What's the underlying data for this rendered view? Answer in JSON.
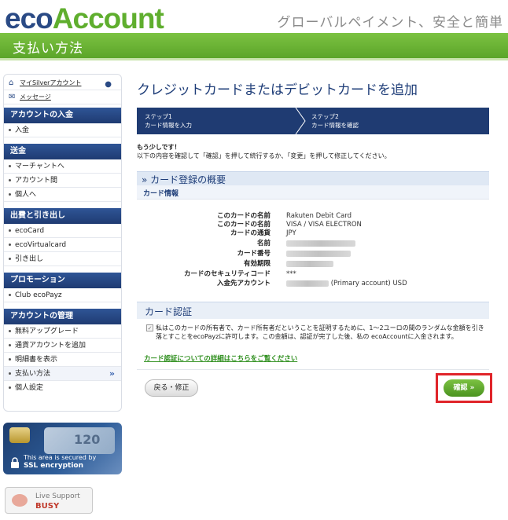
{
  "header": {
    "logo_eco": "eco",
    "logo_account": "Account",
    "tagline": "グローバルペイメント、安全と簡単",
    "page_title": "支払い方法"
  },
  "sidebar": {
    "top_items": [
      {
        "label": "マイSilverアカウント",
        "icon": "home-icon"
      },
      {
        "label": "メッセージ",
        "icon": "mail-icon"
      }
    ],
    "sections": [
      {
        "title": "アカウントの入金",
        "items": [
          "入金"
        ]
      },
      {
        "title": "送金",
        "items": [
          "マーチャントへ",
          "アカウント間",
          "個人へ"
        ]
      },
      {
        "title": "出費と引き出し",
        "items": [
          "ecoCard",
          "ecoVirtualcard",
          "引き出し"
        ]
      },
      {
        "title": "プロモーション",
        "items": [
          "Club ecoPayz"
        ]
      },
      {
        "title": "アカウントの管理",
        "items": [
          "無料アップグレード",
          "通貨アカウントを追加",
          "明細書を表示",
          "支払い方法",
          "個人設定"
        ]
      }
    ],
    "active_item": "支払い方法"
  },
  "ssl_banner": {
    "line1": "This area is secured by",
    "line2": "SSL encryption",
    "card_number": "120"
  },
  "live_support": {
    "label": "Live Support",
    "status": "BUSY"
  },
  "main": {
    "heading": "クレジットカードまたはデビットカードを追加",
    "steps": [
      {
        "step": "ステップ1",
        "desc": "カード情報を入力"
      },
      {
        "step": "ステップ2",
        "desc": "カード情報を確認"
      }
    ],
    "almost": "もう少しです！",
    "instruction": "以下の内容を確認して「確認」を押して続行するか、「変更」を押して修正してください。",
    "summary_title": "» カード登録の概要",
    "card_info_title": "カード情報",
    "details": [
      {
        "key": "このカードの名前",
        "value": "Rakuten Debit Card"
      },
      {
        "key": "このカードの名前",
        "value": "VISA / VISA ELECTRON"
      },
      {
        "key": "カードの通貨",
        "value": "JPY"
      },
      {
        "key": "名前",
        "value": ""
      },
      {
        "key": "カード番号",
        "value": ""
      },
      {
        "key": "有効期限",
        "value": ""
      },
      {
        "key": "カードのセキュリティコード",
        "value": "***"
      },
      {
        "key": "入金先アカウント",
        "value": "(Primary account) USD"
      }
    ],
    "auth_title": "カード認証",
    "auth_text": "私はこのカードの所有者で、カード所有者だということを証明するために、1〜2ユーロの間のランダムな金額を引き落とすことをecoPayzに許可します。この金額は、認証が完了した後、私の ecoAccountに入金されます。",
    "auth_link": "カード認証についての詳細はこちらをご覧ください",
    "back_button": "戻る・修正",
    "confirm_button": "確認 »"
  }
}
